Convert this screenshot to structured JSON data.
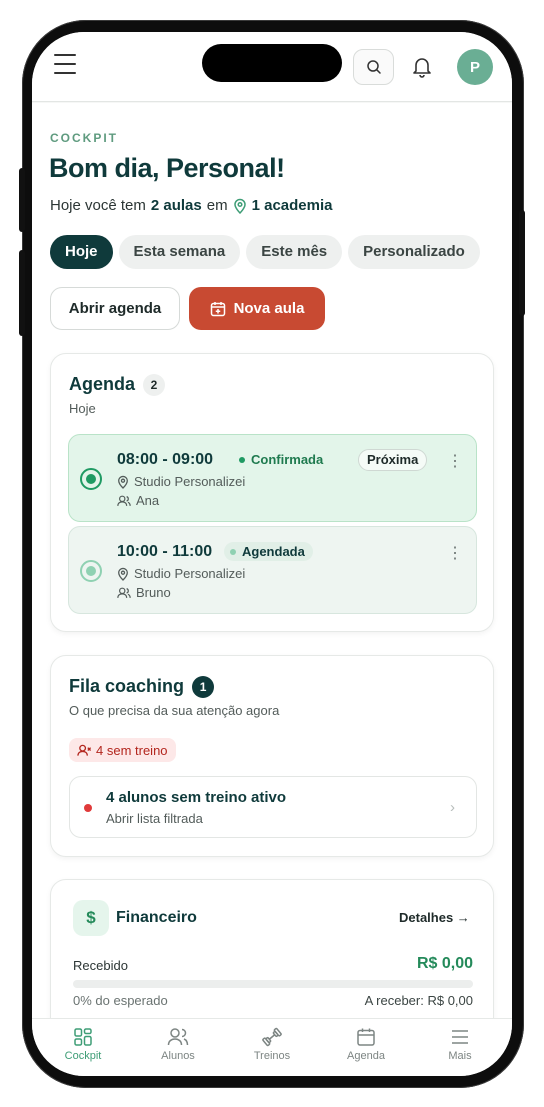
{
  "header": {
    "avatar_initial": "P"
  },
  "page": {
    "eyebrow": "COCKPIT",
    "greeting": "Bom dia, Personal!",
    "summary_prefix": "Hoje você tem",
    "summary_classes": "2 aulas",
    "summary_mid": "em",
    "summary_gyms": "1 academia"
  },
  "filters": [
    "Hoje",
    "Esta semana",
    "Este mês",
    "Personalizado"
  ],
  "actions": {
    "open_agenda": "Abrir agenda",
    "new_class": "Nova aula"
  },
  "agenda": {
    "title": "Agenda",
    "count": "2",
    "subtitle": "Hoje",
    "items": [
      {
        "time": "08:00 - 09:00",
        "status": "Confirmada",
        "tag": "Próxima",
        "location": "Studio Personalizei",
        "client": "Ana"
      },
      {
        "time": "10:00 - 11:00",
        "status": "Agendada",
        "location": "Studio Personalizei",
        "client": "Bruno"
      }
    ]
  },
  "coaching": {
    "title": "Fila coaching",
    "count": "1",
    "subtitle": "O que precisa da sua atenção agora",
    "alert": "4 sem treino",
    "row_title": "4 alunos sem treino ativo",
    "row_sub": "Abrir lista filtrada"
  },
  "finance": {
    "title": "Financeiro",
    "details": "Detalhes →",
    "received_label": "Recebido",
    "received_value": "R$ 0,00",
    "progress": 0,
    "expected_pct": "0% do esperado",
    "to_receive": "A receber: R$ 0,00"
  },
  "tabs": [
    {
      "label": "Cockpit",
      "icon": "grid-icon",
      "active": true
    },
    {
      "label": "Alunos",
      "icon": "users-icon",
      "active": false
    },
    {
      "label": "Treinos",
      "icon": "dumbbell-icon",
      "active": false
    },
    {
      "label": "Agenda",
      "icon": "calendar-icon",
      "active": false
    },
    {
      "label": "Mais",
      "icon": "menu-icon",
      "active": false
    }
  ],
  "colors": {
    "brand_dark": "#0f3a3b",
    "accent_green": "#248a5a",
    "cta_red": "#c84a32",
    "alert_red": "#e03a3a"
  }
}
